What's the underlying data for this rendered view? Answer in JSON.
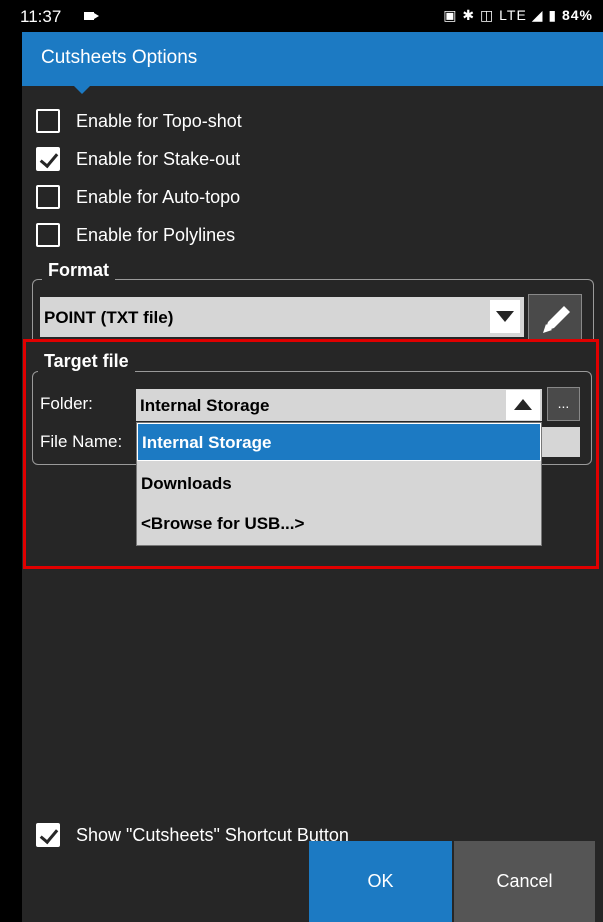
{
  "status_bar": {
    "time": "11:37",
    "indicators": "LTE",
    "battery": "84%"
  },
  "header": {
    "title": "Cutsheets Options"
  },
  "checkboxes": [
    {
      "label": "Enable for Topo-shot",
      "checked": false
    },
    {
      "label": "Enable for Stake-out",
      "checked": true
    },
    {
      "label": "Enable for Auto-topo",
      "checked": false
    },
    {
      "label": "Enable for Polylines",
      "checked": false
    }
  ],
  "format": {
    "section_title": "Format",
    "selected": "POINT (TXT file)"
  },
  "target_file": {
    "section_title": "Target file",
    "folder_label": "Folder:",
    "folder_value": "Internal Storage",
    "file_name_label": "File Name:",
    "browse_label": "...",
    "dropdown_options": [
      "Internal Storage",
      "Downloads",
      "<Browse for USB...>"
    ],
    "selected_option": "Internal Storage"
  },
  "shortcut": {
    "label": "Show \"Cutsheets\" Shortcut Button",
    "checked": true
  },
  "buttons": {
    "ok": "OK",
    "cancel": "Cancel"
  },
  "colors": {
    "accent": "#1c7ac3",
    "highlight": "#e00000",
    "background": "#262626"
  }
}
